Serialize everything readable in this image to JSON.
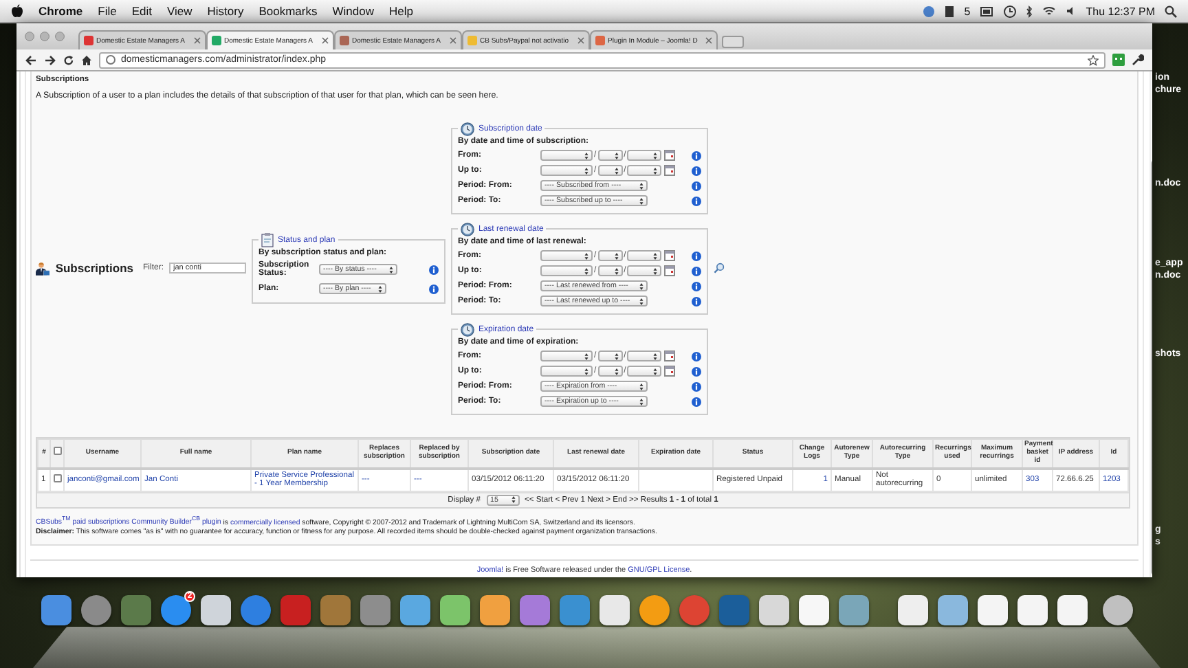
{
  "menu_bar": {
    "app": "Chrome",
    "menus": [
      "File",
      "Edit",
      "View",
      "History",
      "Bookmarks",
      "Window",
      "Help"
    ],
    "status_count": "5",
    "clock": "Thu 12:37 PM"
  },
  "desktop_files": [
    {
      "lines": [
        "ion",
        "chure"
      ]
    },
    {
      "lines": [
        "n.doc"
      ]
    },
    {
      "lines": [
        "e_app",
        "n.doc"
      ]
    },
    {
      "lines": [
        "shots"
      ]
    },
    {
      "lines": [
        "g",
        "s"
      ]
    }
  ],
  "tabs": [
    {
      "title": "Domestic Estate Managers A",
      "selected": false
    },
    {
      "title": "Domestic Estate Managers A",
      "selected": true
    },
    {
      "title": "Domestic Estate Managers A",
      "selected": false
    },
    {
      "title": "CB Subs/Paypal not activatio",
      "selected": false
    },
    {
      "title": "Plugin In Module – Joomla! D",
      "selected": false
    }
  ],
  "address_bar": {
    "url": "domesticmanagers.com/administrator/index.php"
  },
  "page": {
    "title": "Subscriptions",
    "description": "A Subscription of a user to a plan includes the details of that subscription of that user for that plan, which can be seen here."
  },
  "filters": {
    "heading": "Subscriptions",
    "filter_label": "Filter:",
    "filter_value": "jan conti",
    "status_plan": {
      "legend": "Status and plan",
      "caption": "By subscription status and plan:",
      "rows": [
        {
          "label": "Subscription Status:",
          "value": "---- By status ----"
        },
        {
          "label": "Plan:",
          "value": "---- By plan ----"
        }
      ]
    },
    "date_groups": [
      {
        "legend": "Subscription date",
        "caption": "By date and time of subscription:",
        "rows": [
          {
            "kind": "date",
            "label": "From:",
            "separators": [
              "/",
              "/"
            ]
          },
          {
            "kind": "date",
            "label": "Up to:",
            "separators": [
              "/",
              "/"
            ]
          },
          {
            "kind": "select",
            "label": "Period: From:",
            "value": "---- Subscribed from ----"
          },
          {
            "kind": "select",
            "label": "Period: To:",
            "value": "---- Subscribed up to ----"
          }
        ]
      },
      {
        "legend": "Last renewal date",
        "caption": "By date and time of last renewal:",
        "rows": [
          {
            "kind": "date",
            "label": "From:",
            "separators": [
              "/",
              "/"
            ]
          },
          {
            "kind": "date",
            "label": "Up to:",
            "separators": [
              "/",
              "/"
            ]
          },
          {
            "kind": "select",
            "label": "Period: From:",
            "value": "---- Last renewed from ----"
          },
          {
            "kind": "select",
            "label": "Period: To:",
            "value": "---- Last renewed up to ----"
          }
        ]
      },
      {
        "legend": "Expiration date",
        "caption": "By date and time of expiration:",
        "rows": [
          {
            "kind": "date",
            "label": "From:",
            "separators": [
              "/",
              "/"
            ]
          },
          {
            "kind": "date",
            "label": "Up to:",
            "separators": [
              "/",
              "/"
            ]
          },
          {
            "kind": "select",
            "label": "Period: From:",
            "value": "---- Expiration from ----"
          },
          {
            "kind": "select",
            "label": "Period: To:",
            "value": "---- Expiration up to ----"
          }
        ]
      }
    ]
  },
  "table": {
    "columns": [
      {
        "kind": "text",
        "label": "#"
      },
      {
        "kind": "checkbox",
        "checked": false
      },
      {
        "kind": "text",
        "label": "Username"
      },
      {
        "kind": "text",
        "label": "Full name"
      },
      {
        "kind": "text",
        "label": "Plan name"
      },
      {
        "kind": "text",
        "label": "Replaces subscription"
      },
      {
        "kind": "text",
        "label": "Replaced by subscription"
      },
      {
        "kind": "text",
        "label": "Subscription date"
      },
      {
        "kind": "text",
        "label": "Last renewal date"
      },
      {
        "kind": "text",
        "label": "Expiration date"
      },
      {
        "kind": "text",
        "label": "Status"
      },
      {
        "kind": "text",
        "label": "Change Logs"
      },
      {
        "kind": "text",
        "label": "Autorenew Type"
      },
      {
        "kind": "text",
        "label": "Autorecurring Type"
      },
      {
        "kind": "text",
        "label": "Recurrings used"
      },
      {
        "kind": "text",
        "label": "Maximum recurrings"
      },
      {
        "kind": "text",
        "label": "Payment basket id"
      },
      {
        "kind": "text",
        "label": "IP address"
      },
      {
        "kind": "text",
        "label": "Id"
      }
    ],
    "rows": [
      {
        "cells": [
          {
            "kind": "text",
            "text": "1"
          },
          {
            "kind": "checkbox",
            "checked": false
          },
          {
            "kind": "link",
            "text": "janconti@gmail.com"
          },
          {
            "kind": "link",
            "text": "Jan Conti"
          },
          {
            "kind": "link",
            "text": "Private Service Professional - 1 Year Membership"
          },
          {
            "kind": "link",
            "text": "---"
          },
          {
            "kind": "link",
            "text": "---"
          },
          {
            "kind": "text",
            "text": "03/15/2012 06:11:20"
          },
          {
            "kind": "text",
            "text": "03/15/2012 06:11:20"
          },
          {
            "kind": "blank"
          },
          {
            "kind": "text",
            "text": "Registered Unpaid"
          },
          {
            "kind": "link",
            "text": "1"
          },
          {
            "kind": "text",
            "text": "Manual"
          },
          {
            "kind": "text",
            "text": "Not autorecurring"
          },
          {
            "kind": "text",
            "text": "0"
          },
          {
            "kind": "text",
            "text": "unlimited"
          },
          {
            "kind": "link",
            "text": "303"
          },
          {
            "kind": "text",
            "text": "72.66.6.25"
          },
          {
            "kind": "link",
            "text": "1203"
          }
        ]
      }
    ]
  },
  "pagination": {
    "label": "Display #",
    "per_page": "15",
    "summary": "<< Start < Prev 1 Next > End >> Results **1 - 1** of total **1**"
  },
  "footer": {
    "credit": [
      {
        "text": "CBSubs$^{TM}$ paid subscriptions Community Builder$^{CB}$ plugin",
        "kind": "link"
      },
      {
        "text": " is ",
        "kind": "text"
      },
      {
        "text": "commercially licensed",
        "kind": "link"
      },
      {
        "text": " software, Copyright © 2007-2012 and Trademark of Lightning MultiCom SA, Switzerland and its licensors.",
        "kind": "text"
      }
    ],
    "disclaimer": "**Disclaimer:** This software comes \"as is\" with no guarantee for accuracy, function or fitness for any purpose. All recorded items should be double-checked against payment organization transactions."
  },
  "joomla_notice": [
    {
      "text": "Joomla!",
      "kind": "link"
    },
    {
      "text": " is Free Software released under the ",
      "kind": "text"
    },
    {
      "text": "GNU/GPL License",
      "kind": "link"
    },
    {
      "text": ".",
      "kind": "text"
    }
  ],
  "dock": {
    "badge": "2"
  }
}
